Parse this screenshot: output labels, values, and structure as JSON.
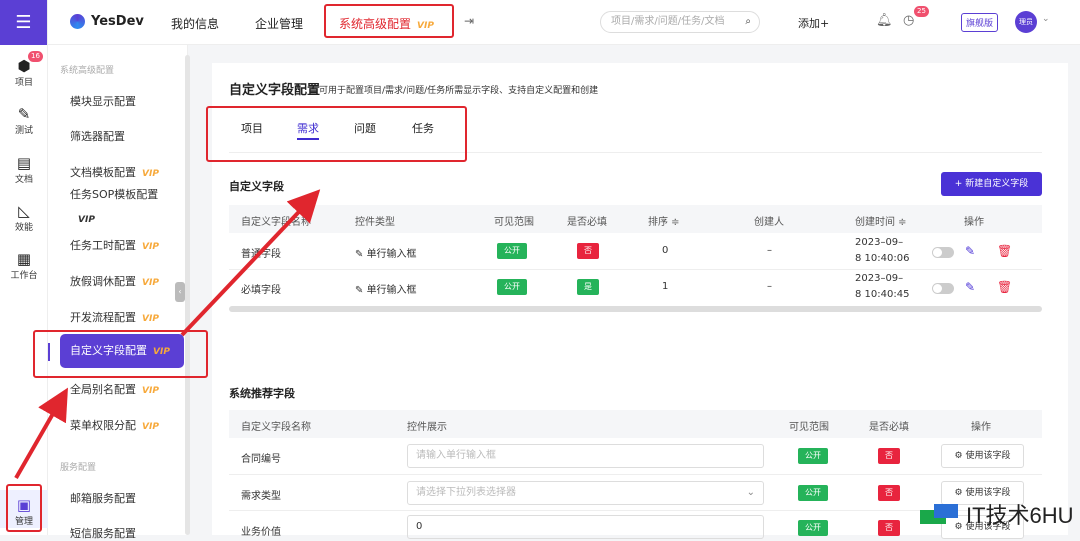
{
  "rail": {
    "items": [
      {
        "label": "项目",
        "badge": "16"
      },
      {
        "label": "测试"
      },
      {
        "label": "文档"
      },
      {
        "label": "效能"
      },
      {
        "label": "工作台"
      }
    ],
    "active_label": "管理"
  },
  "topbar": {
    "logo": "YesDev",
    "nav": [
      "我的信息",
      "企业管理",
      "系统高级配置"
    ],
    "vip": "VIP",
    "search_placeholder": "项目/需求/问题/任务/文档",
    "add_label": "添加+",
    "notice_count": "25",
    "edition": "旗舰版",
    "avatar_text": "理员"
  },
  "sidebar": {
    "section1": "系统高级配置",
    "items": [
      {
        "label": "模块显示配置",
        "vip": ""
      },
      {
        "label": "筛选器配置",
        "vip": ""
      },
      {
        "label": "文档模板配置",
        "vip": "VIP"
      },
      {
        "label": "任务SOP模板配置",
        "vip": "VIP"
      },
      {
        "label": "任务工时配置",
        "vip": "VIP"
      },
      {
        "label": "放假调休配置",
        "vip": "VIP"
      },
      {
        "label": "开发流程配置",
        "vip": "VIP"
      },
      {
        "label": "全局别名配置",
        "vip": "VIP"
      },
      {
        "label": "菜单权限分配",
        "vip": "VIP"
      }
    ],
    "active_item": {
      "label": "自定义字段配置",
      "vip": "VIP"
    },
    "section2": "服务配置",
    "section2_items": [
      "邮箱服务配置",
      "短信服务配置"
    ]
  },
  "main": {
    "title": "自定义字段配置",
    "description": "可用于配置项目/需求/问题/任务所需显示字段、支持自定义配置和创建",
    "tabs": [
      "项目",
      "需求",
      "问题",
      "任务"
    ],
    "active_tab": "需求",
    "custom_section": "自定义字段",
    "new_button": "+ 新建自定义字段",
    "custom_headers": [
      "自定义字段名称",
      "控件类型",
      "可见范围",
      "是否必填",
      "排序 ≑",
      "创建人",
      "创建时间 ≑",
      "操作"
    ],
    "custom_rows": [
      {
        "name": "普通字段",
        "control": "单行输入框",
        "scope": "公开",
        "required": "否",
        "sort": "0",
        "creator": "–",
        "time_line1": "2023–09–",
        "time_line2": "8 10:40:06"
      },
      {
        "name": "必填字段",
        "control": "单行输入框",
        "scope": "公开",
        "required": "是",
        "sort": "1",
        "creator": "–",
        "time_line1": "2023–09–",
        "time_line2": "8 10:40:45"
      }
    ],
    "recommend_section": "系统推荐字段",
    "recommend_headers": [
      "自定义字段名称",
      "控件展示",
      "可见范围",
      "是否必填",
      "操作"
    ],
    "recommend_rows": [
      {
        "name": "合同编号",
        "placeholder": "请输入单行输入框",
        "scope": "公开",
        "required": "否",
        "action": "使用该字段"
      },
      {
        "name": "需求类型",
        "placeholder": "请选择下拉列表选择器",
        "scope": "公开",
        "required": "否",
        "action": "使用该字段"
      },
      {
        "name": "业务价值",
        "placeholder": "0",
        "scope": "公开",
        "required": "否",
        "action": "使用该字段"
      }
    ]
  },
  "watermark": "IT技术6HU",
  "colors": {
    "brand": "#5b3fd4",
    "highlight": "#e0262e",
    "success": "#25b35a",
    "danger": "#e8243e",
    "vip": "#f7a93b"
  }
}
